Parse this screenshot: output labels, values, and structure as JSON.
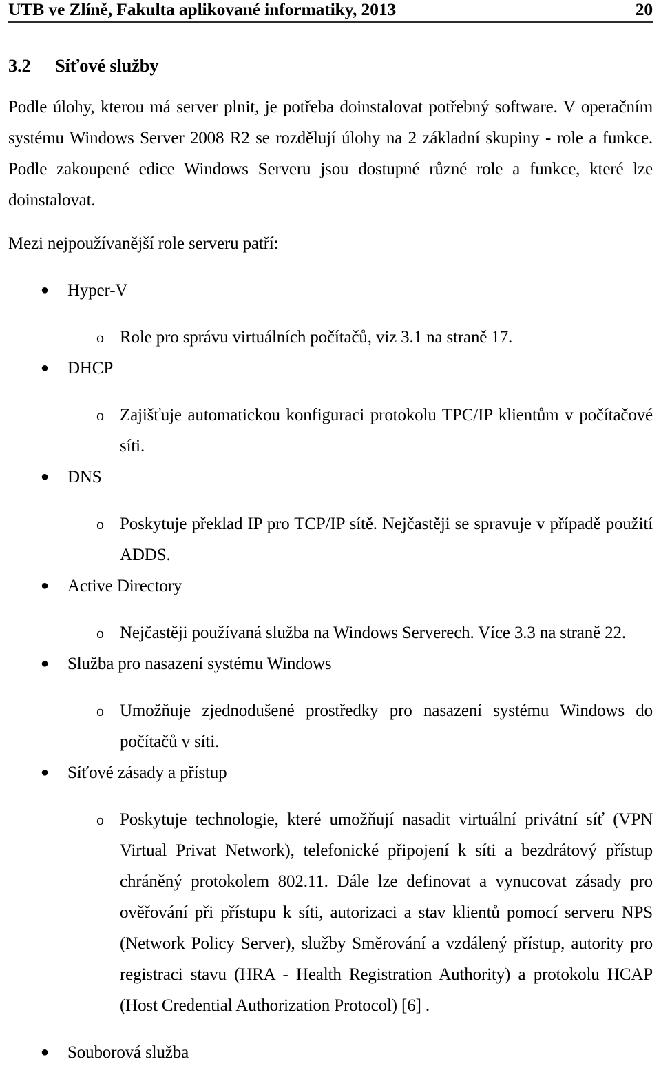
{
  "header": {
    "title": "UTB ve Zlíně, Fakulta aplikované informatiky, 2013",
    "page_number": "20"
  },
  "section": {
    "number": "3.2",
    "title": "Síťové služby"
  },
  "body": {
    "intro_paragraph": "Podle úlohy, kterou má server plnit, je potřeba doinstalovat potřebný software. V operačním systému Windows Server 2008 R2 se rozdělují úlohy na 2 základní skupiny - role a funkce. Podle zakoupené edice Windows Serveru jsou dostupné různé role a funkce, které lze doinstalovat.",
    "lead_in": "Mezi nejpoužívanější role serveru patří:"
  },
  "markers": {
    "level1": "●",
    "level2": "o"
  },
  "items": [
    {
      "label": "Hyper-V",
      "detail": "Role pro správu virtuálních počítačů, viz 3.1 na straně 17."
    },
    {
      "label": "DHCP",
      "detail": "Zajišťuje automatickou konfiguraci protokolu TPC/IP klientům v počítačové síti."
    },
    {
      "label": "DNS",
      "detail": "Poskytuje překlad IP pro TCP/IP sítě. Nejčastěji se spravuje v případě použití ADDS."
    },
    {
      "label": "Active Directory",
      "detail": "Nejčastěji používaná služba na Windows Serverech. Více 3.3 na straně 22."
    },
    {
      "label": "Služba pro nasazení systému Windows",
      "detail": "Umožňuje zjednodušené prostředky pro nasazení systému Windows do počítačů v síti."
    },
    {
      "label": "Síťové zásady a přístup",
      "detail": "Poskytuje technologie, které umožňují nasadit virtuální privátní síť (VPN Virtual Privat Network), telefonické připojení k síti a bezdrátový přístup chráněný protokolem 802.11. Dále lze definovat a vynucovat zásady pro ověřování při přístupu k síti, autorizaci a stav klientů pomocí serveru NPS (Network Policy Server), služby Směrování a vzdálený přístup, autority pro registraci stavu (HRA - Health Registration Authority) a protokolu HCAP (Host Credential Authorization Protocol) [6] ."
    },
    {
      "label": "Souborová služba",
      "detail": ""
    }
  ]
}
